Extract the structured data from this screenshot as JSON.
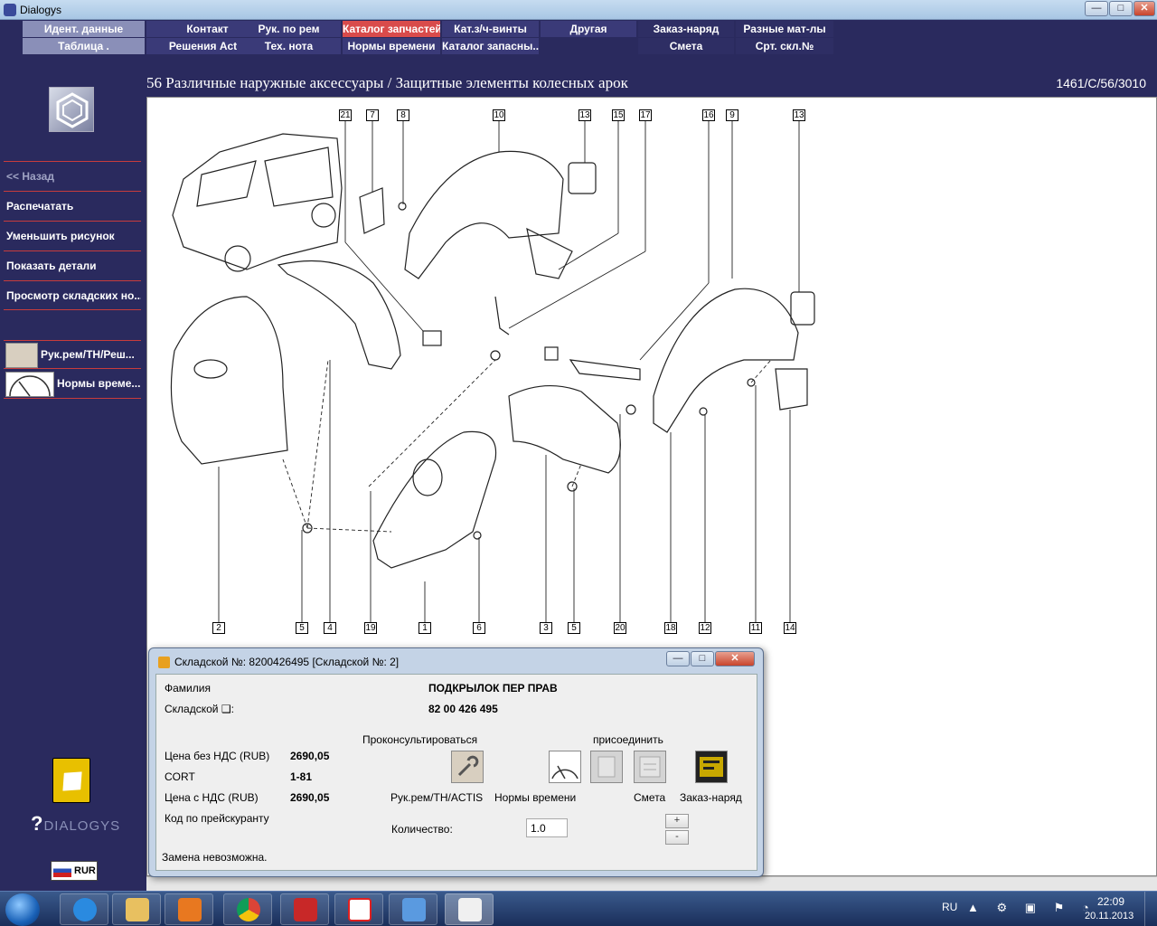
{
  "window": {
    "title": "Dialogys",
    "min_label": "—",
    "max_label": "□",
    "close_label": "✕"
  },
  "nav": {
    "row1": [
      {
        "label": "Идент. данные",
        "bg": "#8a8fb8"
      },
      {
        "label": "Контакт",
        "bg": "#3a3a78"
      },
      {
        "label": "Рук. по рем",
        "bg": "#3a3a78"
      },
      {
        "label": "Каталог запчастей",
        "bg": "#d94b4b"
      },
      {
        "label": "Кат.з/ч-винты",
        "bg": "#3a3a78"
      },
      {
        "label": "Другая",
        "bg": "#3a3a78"
      },
      {
        "label": "Заказ-наряд",
        "bg": "#2e2e64"
      },
      {
        "label": "Разные мат-лы",
        "bg": "#2e2e64"
      }
    ],
    "row2": [
      {
        "label": "Таблица .",
        "bg": "#8a8fb8"
      },
      {
        "label": "Решения Actis",
        "bg": "#3a3a78"
      },
      {
        "label": "Тех. нота",
        "bg": "#3a3a78"
      },
      {
        "label": "Нормы времени",
        "bg": "#3a3a78"
      },
      {
        "label": "Каталог запасны...",
        "bg": "#3a3a78"
      },
      {
        "label": "",
        "bg": "#2a2a5e"
      },
      {
        "label": "Смета",
        "bg": "#2e2e64"
      },
      {
        "label": "Срт. скл.№",
        "bg": "#2e2e64"
      }
    ]
  },
  "sidebar": {
    "items": [
      {
        "label": "<< Назад"
      },
      {
        "label": "Распечатать"
      },
      {
        "label": "Уменьшить рисунок"
      },
      {
        "label": "Показать детали"
      },
      {
        "label": "Просмотр складских но..."
      }
    ],
    "icon_items": [
      {
        "label": "Рук.рем/ТН/Реш...",
        "icon": "repair-manual-icon"
      },
      {
        "label": "Нормы време...",
        "icon": "time-norms-icon"
      }
    ],
    "brand": "DIALOGYS",
    "currency": "RUR"
  },
  "breadcrumb": {
    "path": "56 Различные наружные аксессуары / Защитные элементы колесных арок",
    "code": "1461/C/56/3010"
  },
  "diagram": {
    "top_callouts": [
      "21",
      "7",
      "8",
      "10",
      "13",
      "15",
      "17",
      "16",
      "9",
      "13"
    ],
    "bottom_callouts": [
      "2",
      "5",
      "4",
      "19",
      "1",
      "6",
      "3",
      "5",
      "20",
      "18",
      "12",
      "11",
      "14"
    ]
  },
  "dialog": {
    "title": "Складской №: 8200426495 [Складской №: 2]",
    "family_label": "Фамилия",
    "family_value": "ПОДКРЫЛОК ПЕР ПРАВ",
    "part_label": "Складской ❑:",
    "part_value": "82 00 426 495",
    "consult_label": "Проконсультироваться",
    "attach_label": "присоединить",
    "price_no_vat_label": "Цена без НДС (RUB)",
    "price_no_vat_value": "2690,05",
    "cort_label": "CORT",
    "cort_value": "1-81",
    "price_vat_label": "Цена с НДС (RUB)",
    "price_vat_value": "2690,05",
    "pricelist_label": "Код по прейскуранту",
    "btn_repair": "Рук.рем/ТН/ACTIS",
    "btn_norms": "Нормы времени",
    "btn_estimate": "Смета",
    "btn_order": "Заказ-наряд",
    "qty_label": "Количество:",
    "qty_value": "1.0",
    "plus": "+",
    "minus": "-",
    "status": "Замена невозможна."
  },
  "taskbar": {
    "lang": "RU",
    "time": "22:09",
    "date": "20.11.2013"
  }
}
